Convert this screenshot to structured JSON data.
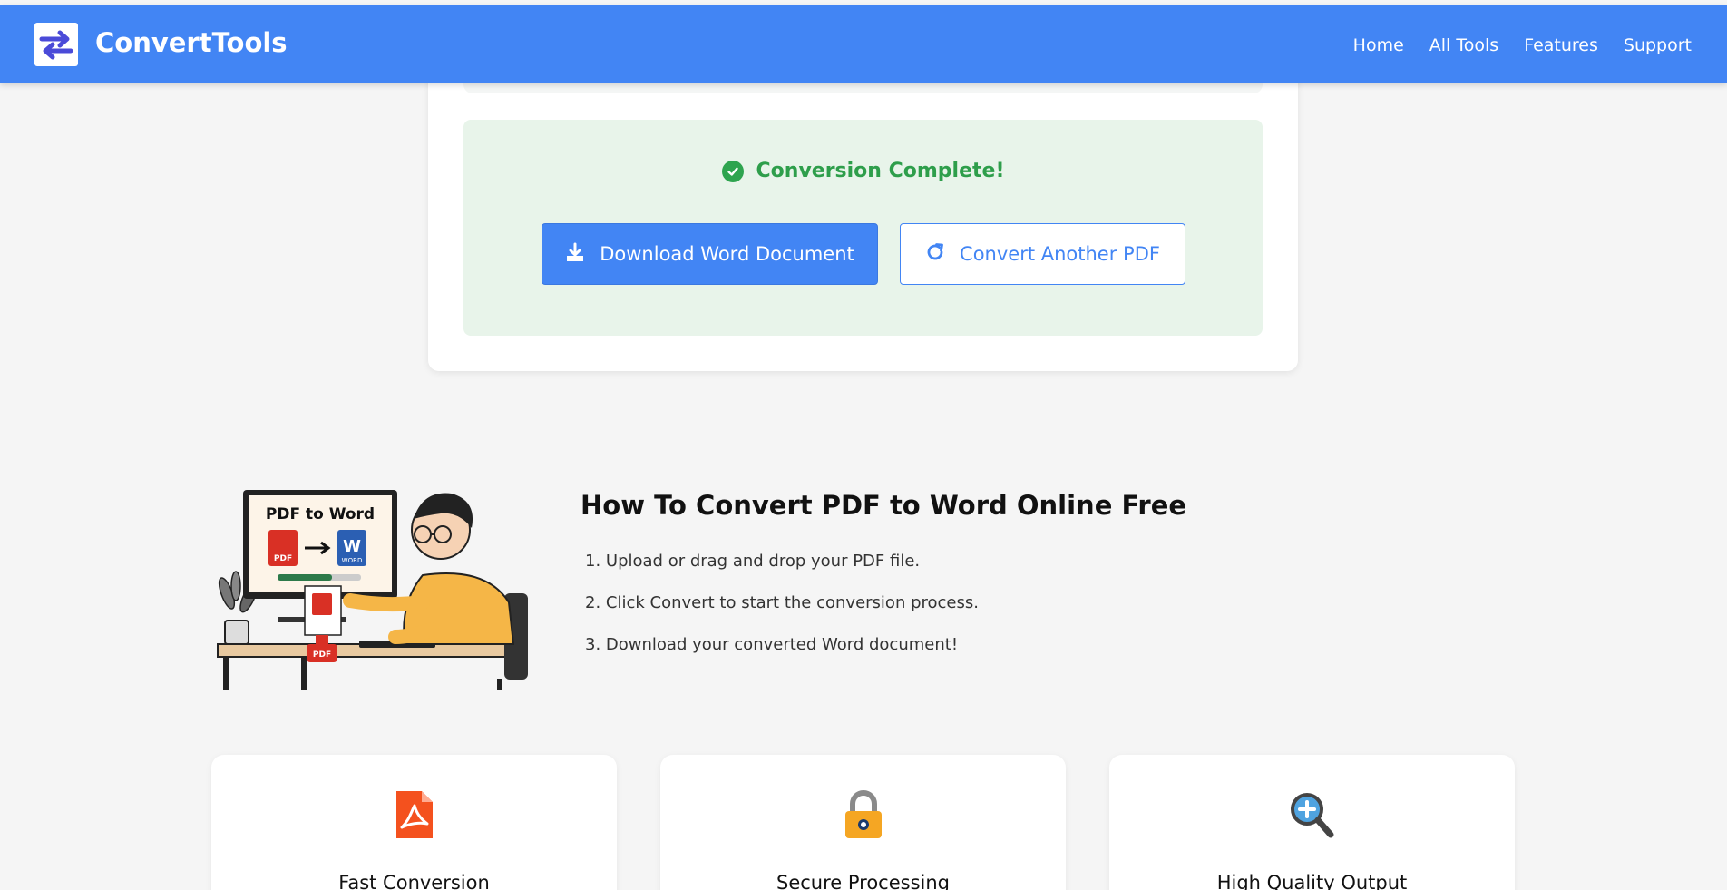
{
  "header": {
    "brand": "ConvertTools",
    "logo_icon": "swap-arrows-icon",
    "nav": [
      "Home",
      "All Tools",
      "Features",
      "Support"
    ]
  },
  "result": {
    "status_icon": "check-circle-icon",
    "status_text": "Conversion Complete!",
    "download_label": "Download Word Document",
    "download_icon": "download-icon",
    "convert_another_label": "Convert Another PDF",
    "convert_another_icon": "redo-icon",
    "success_color": "#2e9e4b"
  },
  "howto": {
    "illustration_caption": "PDF to Word",
    "title": "How To Convert PDF to Word Online Free",
    "steps": [
      "1. Upload or drag and drop your PDF file.",
      "2. Click Convert to start the conversion process.",
      "3. Download your converted Word document!"
    ]
  },
  "features": [
    {
      "icon": "pdf-file-icon",
      "title": "Fast Conversion"
    },
    {
      "icon": "padlock-icon",
      "title": "Secure Processing"
    },
    {
      "icon": "magnifier-plus-icon",
      "title": "High Quality Output"
    }
  ],
  "colors": {
    "brand": "#4285f4",
    "success_bg": "#e8f4ea",
    "page_bg": "#f5f5f5"
  }
}
